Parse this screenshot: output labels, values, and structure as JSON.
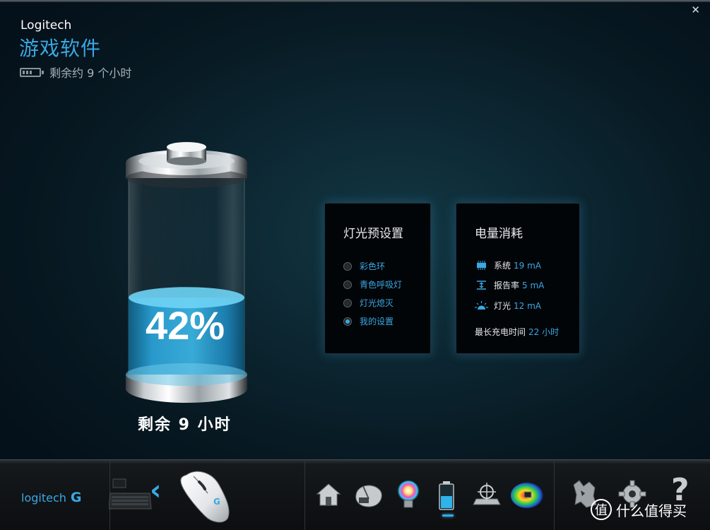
{
  "window": {
    "close_glyph": "✕"
  },
  "header": {
    "brand": "Logitech",
    "title": "游戏软件",
    "battery_status": "剩余约 9 个小时"
  },
  "battery": {
    "percent_label": "42%",
    "level": 0.42,
    "remaining_label": "剩余 9 小时"
  },
  "lighting_presets": {
    "title": "灯光预设置",
    "options": [
      {
        "label": "彩色环",
        "selected": false
      },
      {
        "label": "青色呼吸灯",
        "selected": false
      },
      {
        "label": "灯光熄灭",
        "selected": false
      },
      {
        "label": "我的设置",
        "selected": true
      }
    ]
  },
  "power_usage": {
    "title": "电量消耗",
    "rows": [
      {
        "icon": "chip-icon",
        "label": "系统",
        "value": "19 mA"
      },
      {
        "icon": "report-rate-icon",
        "label": "报告率",
        "value": "5 mA"
      },
      {
        "icon": "light-icon",
        "label": "灯光",
        "value": "12 mA"
      }
    ],
    "max_charge_label": "最长充电时间",
    "max_charge_value": "22 小时"
  },
  "taskbar": {
    "logo_text": "logitech",
    "logo_mark": "G",
    "back_glyph": "‹",
    "buttons": [
      "home-icon",
      "mouse-buttons-icon",
      "lighting-icon",
      "battery-icon",
      "pointer-settings-icon",
      "heatmap-icon",
      "profile-icon",
      "settings-icon",
      "help-icon"
    ],
    "help_glyph": "?"
  },
  "watermark": {
    "badge": "值",
    "text": "什么值得买"
  },
  "colors": {
    "accent": "#3aa8e3",
    "background": "#0c2631",
    "liquid": "#2aa3d8"
  }
}
